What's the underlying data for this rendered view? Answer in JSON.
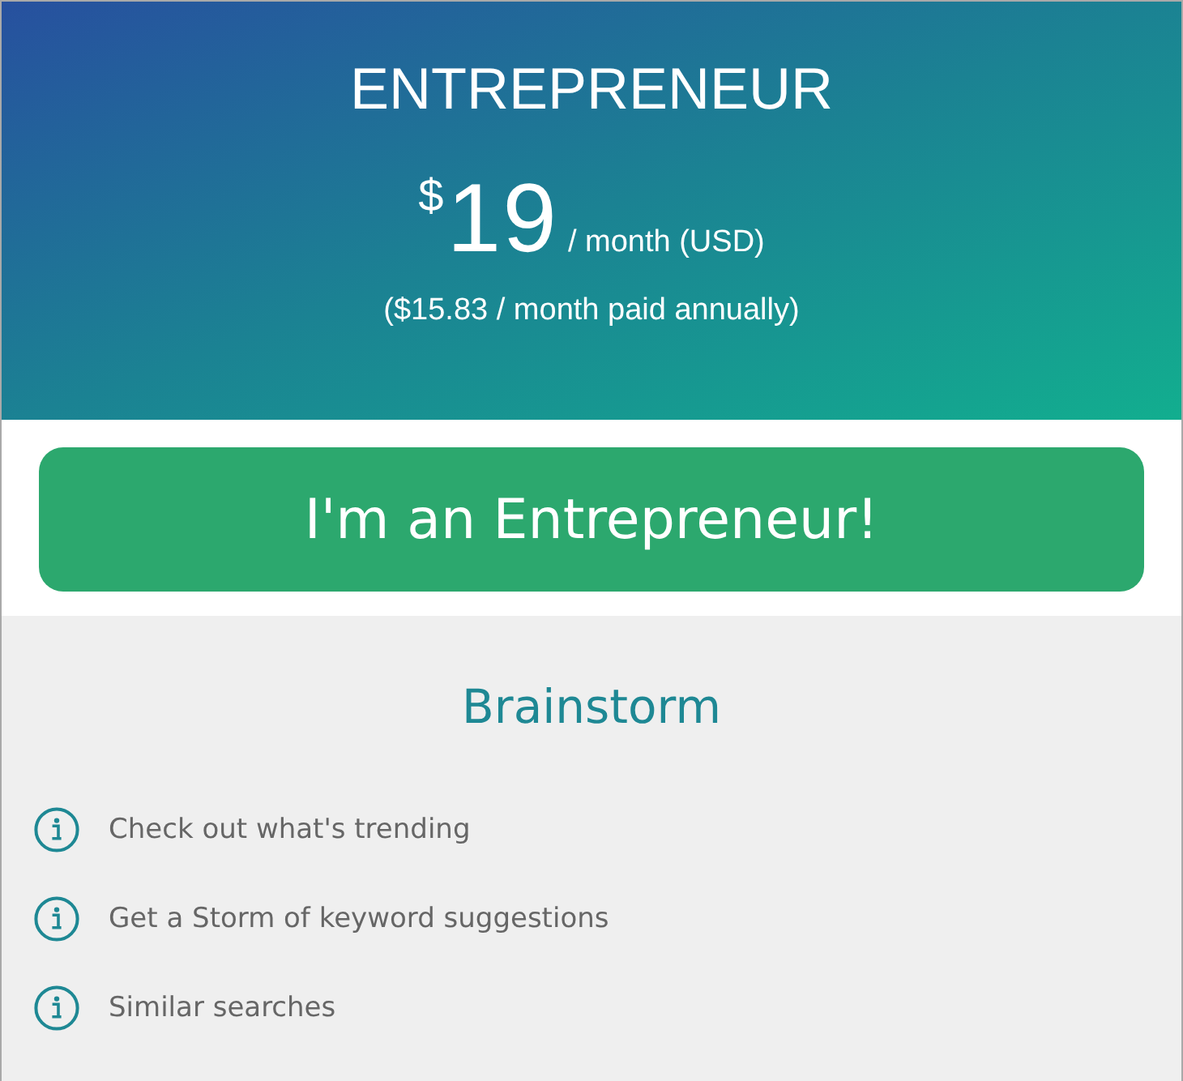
{
  "plan": {
    "name": "ENTREPRENEUR",
    "currency": "$",
    "price": "19",
    "period": "/ month (USD)",
    "annual_note": "($15.83 / month paid annually)"
  },
  "cta_button": {
    "label": "I'm an Entrepreneur!"
  },
  "features_section": {
    "title": "Brainstorm",
    "items": [
      {
        "label": "Check out what's trending"
      },
      {
        "label": "Get a Storm of keyword suggestions"
      },
      {
        "label": "Similar searches"
      }
    ]
  }
}
